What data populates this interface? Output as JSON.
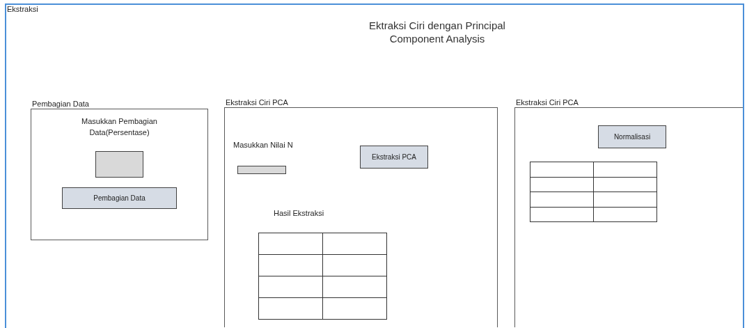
{
  "window": {
    "title": "Ekstraksi"
  },
  "heading": "Ektraksi Ciri dengan Principal Component Analysis",
  "panels": [
    {
      "label": "Pembagian Data",
      "kind": "split",
      "items": [
        {
          "kind": "text",
          "text": "Masukkan Pembagian Data(Persentase)"
        },
        {
          "kind": "field"
        },
        {
          "kind": "button",
          "label": "Pembagian Data"
        }
      ]
    },
    {
      "label": "Ekstraksi Ciri PCA",
      "kind": "extract",
      "items": [
        {
          "kind": "text",
          "text": "Masukkan Nilai N"
        },
        {
          "kind": "field"
        },
        {
          "kind": "button",
          "label": "Ekstraksi PCA"
        },
        {
          "kind": "text",
          "text": "Hasil Ekstraksi"
        },
        {
          "kind": "table",
          "rows": [
            {
              "cells": [
                {
                  "kind": "empty"
                },
                {
                  "kind": "empty"
                }
              ]
            },
            {
              "cells": [
                {
                  "kind": "empty"
                },
                {
                  "kind": "empty"
                }
              ]
            },
            {
              "cells": [
                {
                  "kind": "empty"
                },
                {
                  "kind": "empty"
                }
              ]
            },
            {
              "cells": [
                {
                  "kind": "empty"
                },
                {
                  "kind": "empty"
                }
              ]
            }
          ]
        }
      ]
    },
    {
      "label": "Ekstraksi Ciri PCA",
      "kind": "normalize",
      "items": [
        {
          "kind": "button",
          "label": "Normalisasi"
        },
        {
          "kind": "table",
          "rows": [
            {
              "cells": [
                {
                  "kind": "empty"
                },
                {
                  "kind": "empty"
                }
              ]
            },
            {
              "cells": [
                {
                  "kind": "empty"
                },
                {
                  "kind": "empty"
                }
              ]
            },
            {
              "cells": [
                {
                  "kind": "empty"
                },
                {
                  "kind": "empty"
                }
              ]
            },
            {
              "cells": [
                {
                  "kind": "empty"
                },
                {
                  "kind": "empty"
                }
              ]
            }
          ]
        }
      ]
    }
  ]
}
